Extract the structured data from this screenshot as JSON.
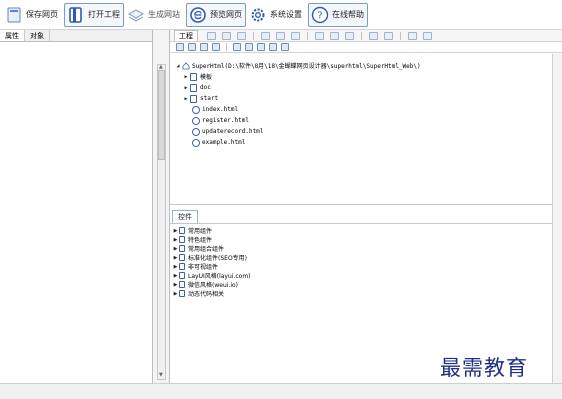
{
  "toolbar": {
    "save_label": "保存网页",
    "open_label": "打开工程",
    "generate_label": "生成网站",
    "preview_label": "预览网页",
    "settings_label": "系统设置",
    "help_label": "在线帮助"
  },
  "left_panel": {
    "tabs": [
      "属性",
      "对象"
    ]
  },
  "project_panel": {
    "tab_label": "工程",
    "root_label": "SuperHtml(D:\\软件\\8月\\18\\金蝴蝶网页设计器\\superhtml\\SuperHtml_Web\\)",
    "folders": [
      "模板",
      "doc",
      "start"
    ],
    "files": [
      "index.html",
      "register.html",
      "updaterecord.html",
      "example.html"
    ]
  },
  "controls_panel": {
    "tab_label": "控件",
    "groups": [
      "常用组件",
      "特色组件",
      "常用组合组件",
      "标准化组件(SEO专用)",
      "非可视组件",
      "LayUI风格(layui.com)",
      "微信风格(weui.io)",
      "动态代码相关"
    ]
  },
  "watermark": "最需教育",
  "colors": {
    "accent": "#3a62b0",
    "watermark": "#1f2f88"
  }
}
